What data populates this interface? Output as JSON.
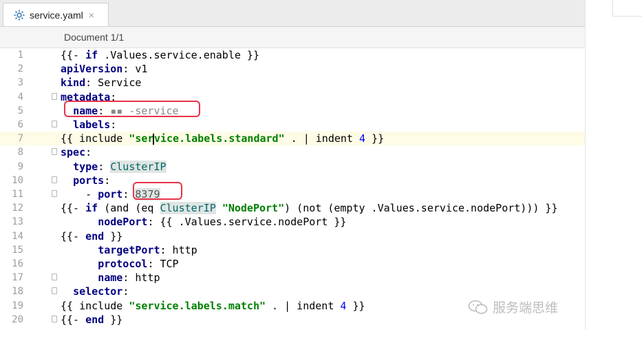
{
  "tab": {
    "title": "service.yaml",
    "close": "×"
  },
  "breadcrumb": "Document 1/1",
  "lines": [
    {
      "n": "1",
      "t": "{{- if .Values.service.enable }}"
    },
    {
      "n": "2",
      "t": "apiVersion: v1"
    },
    {
      "n": "3",
      "t": "kind: Service"
    },
    {
      "n": "4",
      "t": "metadata:"
    },
    {
      "n": "5",
      "t": "  name: ▪▪ -service"
    },
    {
      "n": "6",
      "t": "  labels:"
    },
    {
      "n": "7",
      "t": "{{ include \"service.labels.standard\" . | indent 4 }}"
    },
    {
      "n": "8",
      "t": "spec:"
    },
    {
      "n": "9",
      "t": "  type: ClusterIP"
    },
    {
      "n": "10",
      "t": "  ports:"
    },
    {
      "n": "11",
      "t": "    - port: 8379"
    },
    {
      "n": "12",
      "t": "{{- if (and (eq ClusterIP \"NodePort\") (not (empty .Values.service.nodePort))) }}"
    },
    {
      "n": "13",
      "t": "      nodePort: {{ .Values.service.nodePort }}"
    },
    {
      "n": "14",
      "t": "{{- end }}"
    },
    {
      "n": "15",
      "t": "      targetPort: http"
    },
    {
      "n": "16",
      "t": "      protocol: TCP"
    },
    {
      "n": "17",
      "t": "      name: http"
    },
    {
      "n": "18",
      "t": "  selector:"
    },
    {
      "n": "19",
      "t": "{{ include \"service.labels.match\" . | indent 4 }}"
    },
    {
      "n": "20",
      "t": "{{- end }}"
    }
  ],
  "watermark": "服务端思维",
  "colors": {
    "keyword": "#000080",
    "string": "#008000",
    "number": "#0000ff",
    "highlight_box": "#e8334a",
    "current_line": "#fefbe6"
  }
}
